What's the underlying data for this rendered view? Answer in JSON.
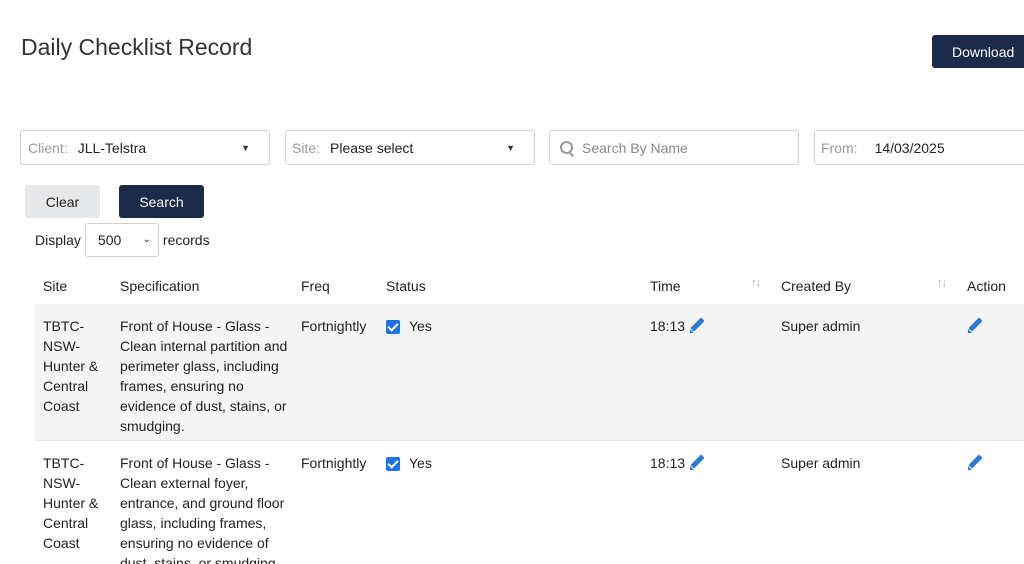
{
  "header": {
    "title": "Daily Checklist Record",
    "download_label": "Download"
  },
  "filters": {
    "client": {
      "label": "Client:",
      "value": "JLL-Telstra"
    },
    "site": {
      "label": "Site:",
      "value": "Please select"
    },
    "search": {
      "placeholder": "Search By Name",
      "value": ""
    },
    "from": {
      "label": "From:",
      "value": "14/03/2025"
    }
  },
  "actions": {
    "clear_label": "Clear",
    "search_label": "Search"
  },
  "display": {
    "prefix": "Display",
    "value": "500",
    "suffix": "records"
  },
  "table": {
    "columns": {
      "site": "Site",
      "specification": "Specification",
      "freq": "Freq",
      "status": "Status",
      "time": "Time",
      "created_by": "Created By",
      "action": "Action"
    },
    "sort_glyph": "↑↓",
    "rows": [
      {
        "site": "TBTC-NSW-Hunter & Central Coast",
        "specification": "Front of House - Glass - Clean internal partition and perimeter glass, including frames, ensuring no evidence of dust, stains, or smudging.",
        "freq": "Fortnightly",
        "status": "Yes",
        "time": "18:13",
        "created_by": "Super admin"
      },
      {
        "site": "TBTC-NSW-Hunter & Central Coast",
        "specification": "Front of House - Glass - Clean external foyer, entrance, and ground floor glass, including frames, ensuring no evidence of dust, stains, or smudging.",
        "freq": "Fortnightly",
        "status": "Yes",
        "time": "18:13",
        "created_by": "Super admin"
      }
    ]
  },
  "colors": {
    "primary_button": "#1c2a4a",
    "checkbox": "#1a73e8",
    "edit_icon": "#2a7bd6"
  },
  "icons": {
    "search": "search-icon",
    "edit": "pencil-icon",
    "dropdown": "caret-down-icon",
    "sort": "sort-icon"
  }
}
